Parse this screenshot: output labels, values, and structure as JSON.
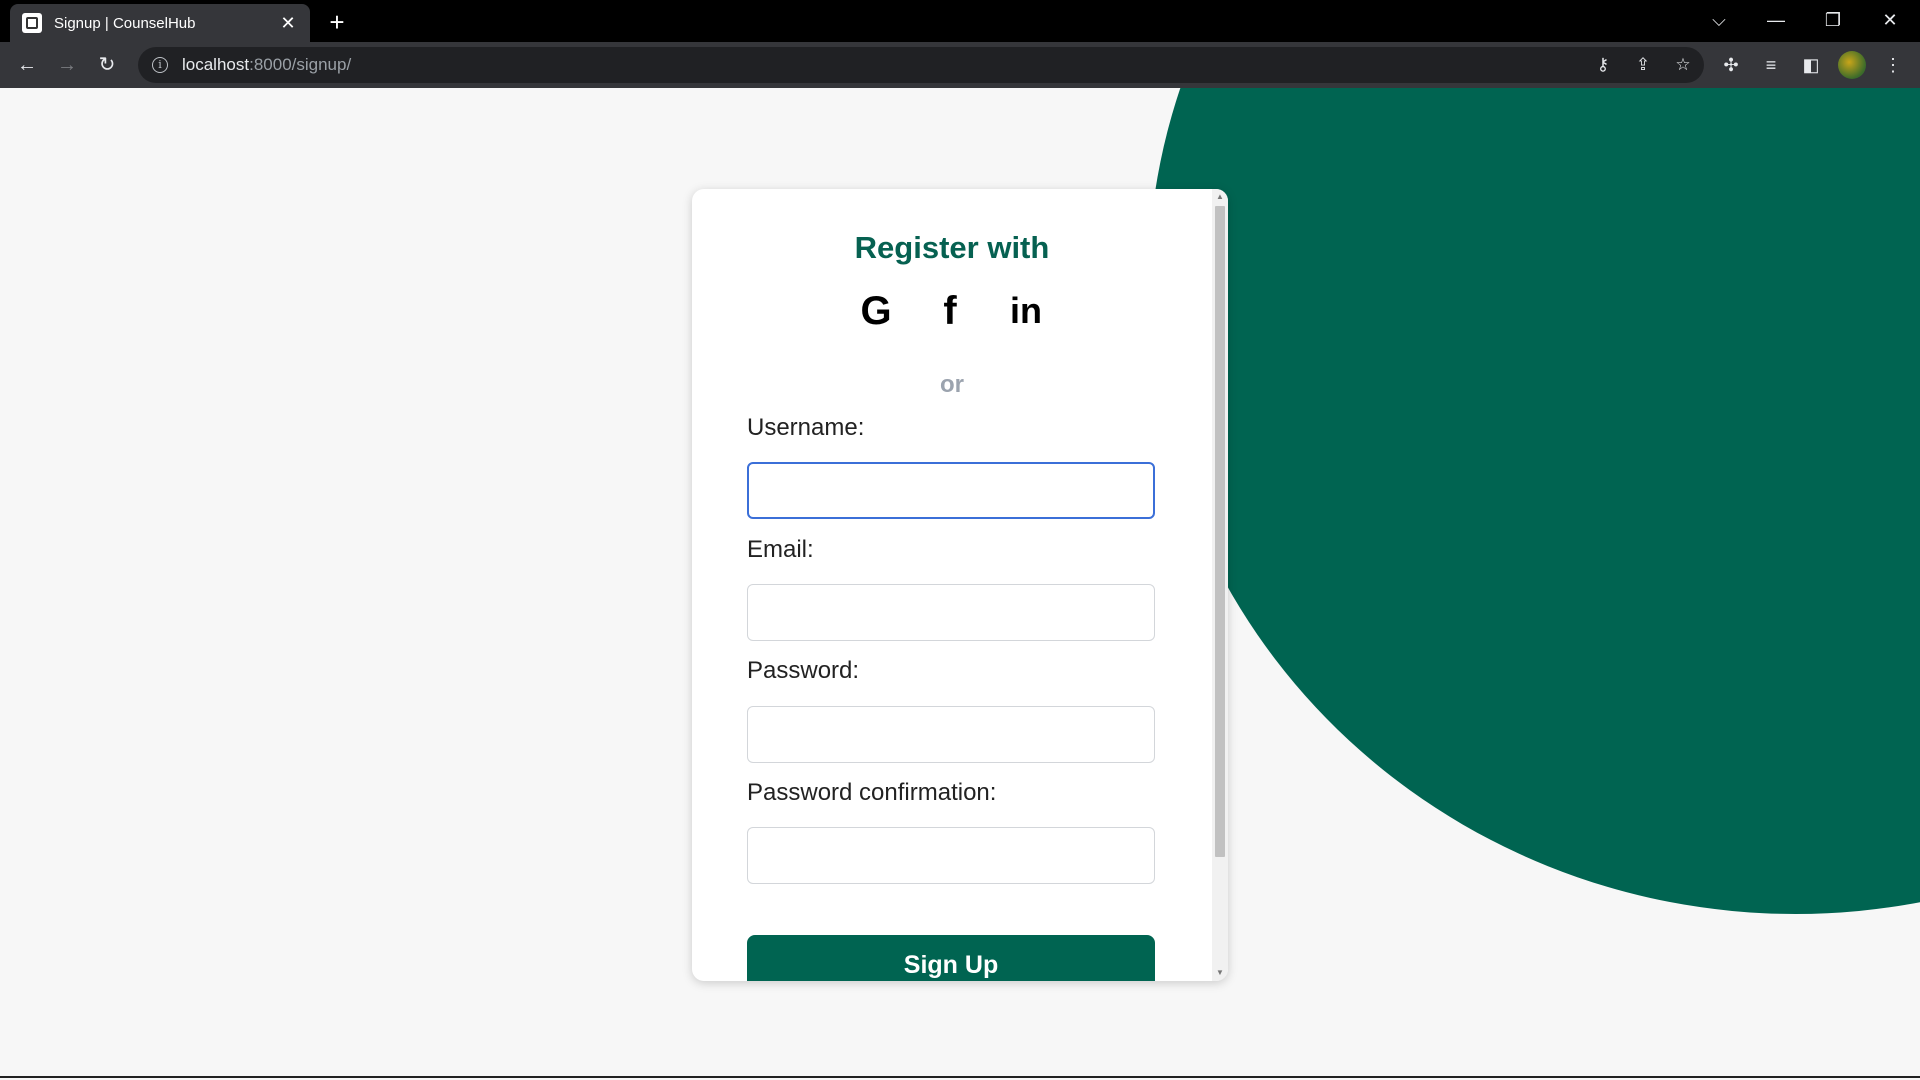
{
  "browser": {
    "tab_title": "Signup | CounselHub",
    "tab_close": "✕",
    "new_tab": "+",
    "url_host": "localhost",
    "url_path": ":8000/signup/",
    "window_controls": {
      "dropdown": "⌵",
      "minimize": "—",
      "restore": "❐",
      "close": "✕"
    },
    "nav": {
      "back": "←",
      "forward": "→",
      "reload": "↻"
    },
    "info_glyph": "i",
    "omnibox_icons": {
      "key": "⚷",
      "share": "⇪",
      "star": "☆"
    },
    "toolbar_icons": {
      "extensions": "✣",
      "media": "≡",
      "side_panel": "◧",
      "menu": "⋮"
    }
  },
  "form": {
    "heading": "Register with",
    "social": {
      "google": "G",
      "facebook": "f",
      "linkedin": "in"
    },
    "divider": "or",
    "username_label": "Username:",
    "username_value": "",
    "email_label": "Email:",
    "email_value": "",
    "password_label": "Password:",
    "password_value": "",
    "password_confirm_label": "Password confirmation:",
    "password_confirm_value": "",
    "submit_label": "Sign Up"
  },
  "scrollbar": {
    "up": "▲",
    "down": "▼"
  },
  "colors": {
    "brand_green": "#006451",
    "heading_green": "#066151",
    "focus_blue": "#3b6fd8",
    "page_bg": "#f7f7f7"
  }
}
